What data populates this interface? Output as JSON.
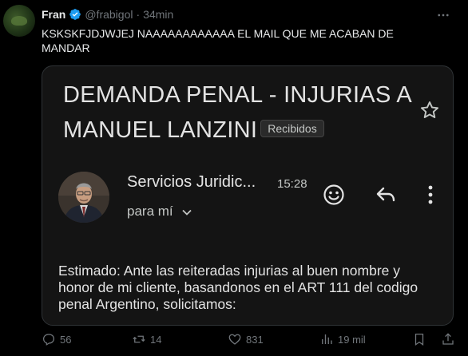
{
  "tweet": {
    "author_name": "Fran",
    "handle": "@frabigol",
    "separator": "·",
    "time_ago": "34min",
    "text": "KSKSKFJDJWJEJ NAAAAAAAAAAAA EL MAIL QUE ME ACABAN DE MANDAR"
  },
  "email": {
    "subject": "DEMANDA PENAL - INJURIAS A MANUEL LANZINI",
    "label": "Recibidos",
    "sender_name": "Servicios Juridic...",
    "time": "15:28",
    "recipient": "para mí",
    "body": "Estimado: Ante las reiteradas injurias al buen nombre y honor de mi cliente, basandonos en el ART 111 del codigo penal Argentino, solicitamos:"
  },
  "actions": {
    "replies": "56",
    "retweets": "14",
    "likes": "831",
    "views": "19 mil"
  },
  "colors": {
    "verified": "#1d9bf0",
    "muted": "#71767b",
    "card_bg": "#141414"
  },
  "icons": [
    "verified-badge-icon",
    "more-icon",
    "star-icon",
    "emoji-icon",
    "reply-icon",
    "more-vert-icon",
    "chevron-down-icon",
    "reply-count-icon",
    "retweet-icon",
    "like-icon",
    "views-icon",
    "bookmark-icon",
    "share-icon"
  ]
}
